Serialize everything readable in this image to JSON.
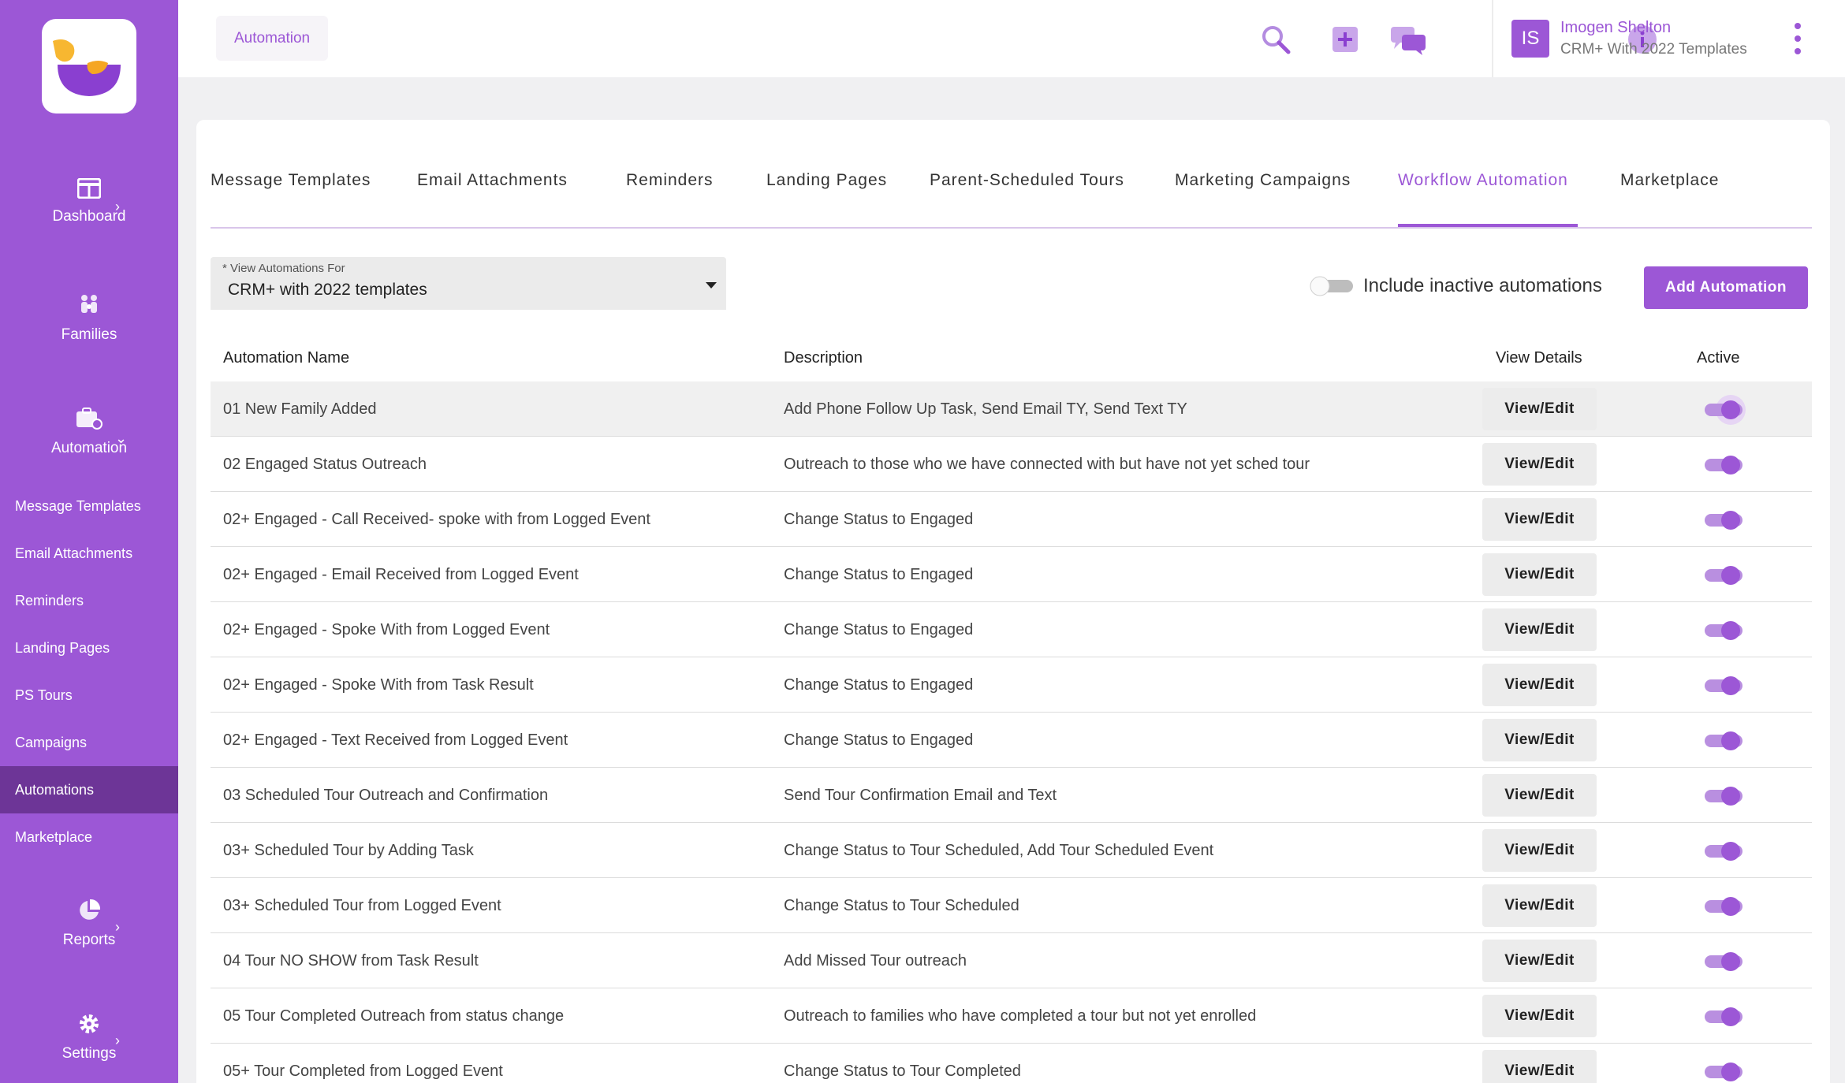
{
  "sidebar": {
    "main": [
      {
        "label": "Dashboard",
        "icon": "dashboard-icon"
      },
      {
        "label": "Families",
        "icon": "families-icon"
      },
      {
        "label": "Automation",
        "icon": "automation-icon"
      },
      {
        "label": "Reports",
        "icon": "reports-icon"
      },
      {
        "label": "Settings",
        "icon": "gear-icon"
      }
    ],
    "sub_items": [
      "Message Templates",
      "Email Attachments",
      "Reminders",
      "Landing Pages",
      "PS Tours",
      "Campaigns",
      "Automations",
      "Marketplace"
    ],
    "active_sub": "Automations"
  },
  "header": {
    "breadcrumb": "Automation",
    "icons": [
      "search-icon",
      "add-icon",
      "chat-icon",
      "info-icon"
    ],
    "user": {
      "initials": "IS",
      "name": "Imogen Shelton",
      "org": "CRM+ With 2022 Templates"
    }
  },
  "tabs": [
    "Message Templates",
    "Email Attachments",
    "Reminders",
    "Landing Pages",
    "Parent-Scheduled Tours",
    "Marketing Campaigns",
    "Workflow Automation",
    "Marketplace"
  ],
  "active_tab": "Workflow Automation",
  "filter": {
    "label": "* View Automations For",
    "value": "CRM+ with 2022 templates"
  },
  "include_inactive": {
    "label": "Include inactive automations",
    "on": false
  },
  "add_button": "Add Automation",
  "table": {
    "headers": {
      "name": "Automation Name",
      "description": "Description",
      "details": "View Details",
      "active": "Active"
    },
    "view_label": "View/Edit",
    "rows": [
      {
        "name": "01 New Family Added",
        "description": "Add Phone Follow Up Task, Send Email TY, Send Text TY",
        "active": true
      },
      {
        "name": "02 Engaged Status Outreach",
        "description": "Outreach to those who we have connected with but have not yet sched tour",
        "active": true
      },
      {
        "name": "02+ Engaged - Call Received- spoke with from Logged Event",
        "description": "Change Status to Engaged",
        "active": true
      },
      {
        "name": "02+ Engaged - Email Received from Logged Event",
        "description": "Change Status to Engaged",
        "active": true
      },
      {
        "name": "02+ Engaged - Spoke With from Logged Event",
        "description": "Change Status to Engaged",
        "active": true
      },
      {
        "name": "02+ Engaged - Spoke With from Task Result",
        "description": "Change Status to Engaged",
        "active": true
      },
      {
        "name": "02+ Engaged - Text Received from Logged Event",
        "description": "Change Status to Engaged",
        "active": true
      },
      {
        "name": "03 Scheduled Tour Outreach and Confirmation",
        "description": "Send Tour Confirmation Email and Text",
        "active": true
      },
      {
        "name": "03+ Scheduled Tour by Adding Task",
        "description": "Change Status to Tour Scheduled, Add Tour Scheduled Event",
        "active": true
      },
      {
        "name": "03+ Scheduled Tour from Logged Event",
        "description": "Change Status to Tour Scheduled",
        "active": true
      },
      {
        "name": "04 Tour NO SHOW from Task Result",
        "description": "Add Missed Tour outreach",
        "active": true
      },
      {
        "name": "05 Tour Completed Outreach from status change",
        "description": "Outreach to families who have completed a tour but not yet enrolled",
        "active": true
      },
      {
        "name": "05+ Tour Completed from Logged Event",
        "description": "Change Status to Tour Completed",
        "active": true
      }
    ]
  },
  "colors": {
    "brand": "#9c57d6",
    "sidebar_active": "#6d3597",
    "toggle_track": "#b98fe0"
  }
}
